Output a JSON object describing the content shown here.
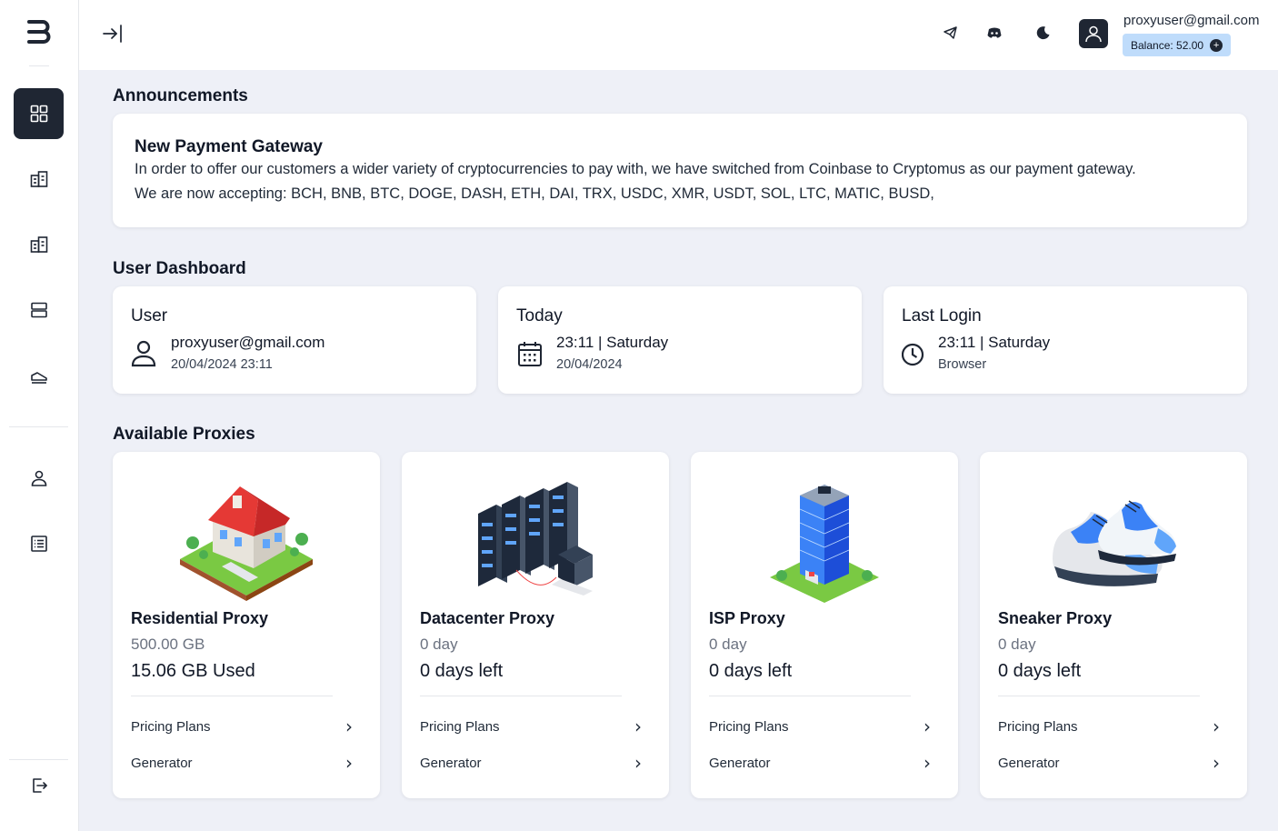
{
  "header": {
    "user_email": "proxyuser@gmail.com",
    "balance_label": "Balance: 52.00",
    "balance_plus": "+"
  },
  "sidebar": {
    "items": [
      {
        "name": "dashboard",
        "icon": "grid-icon",
        "active": true
      },
      {
        "name": "datacenter",
        "icon": "buildings-icon"
      },
      {
        "name": "isp",
        "icon": "buildings-icon"
      },
      {
        "name": "servers",
        "icon": "server-icon"
      },
      {
        "name": "sneaker",
        "icon": "shoe-icon"
      },
      {
        "name": "account",
        "icon": "user-icon"
      },
      {
        "name": "orders",
        "icon": "list-icon"
      },
      {
        "name": "logout",
        "icon": "logout-icon"
      }
    ]
  },
  "announcements": {
    "section_title": "Announcements",
    "title": "New Payment Gateway",
    "line1": "In order to offer our customers a wider variety of cryptocurrencies to pay with, we have switched from Coinbase to Cryptomus as our payment gateway.",
    "line2": "We are now accepting: BCH, BNB, BTC, DOGE, DASH, ETH, DAI, TRX, USDC, XMR, USDT, SOL, LTC, MATIC, BUSD,"
  },
  "dashboard": {
    "section_title": "User Dashboard",
    "cards": [
      {
        "label": "User",
        "main": "proxyuser@gmail.com",
        "sub": "20/04/2024 23:11",
        "icon": "user-icon"
      },
      {
        "label": "Today",
        "main": "23:11 | Saturday",
        "sub": "20/04/2024",
        "icon": "calendar-icon"
      },
      {
        "label": "Last Login",
        "main": "23:11 | Saturday",
        "sub": "Browser",
        "icon": "clock-icon"
      }
    ]
  },
  "proxies": {
    "section_title": "Available Proxies",
    "cards": [
      {
        "name": "Residential Proxy",
        "qty": "500.00 GB",
        "status": "15.06 GB Used",
        "link1": "Pricing Plans",
        "link2": "Generator",
        "image": "house-illustration"
      },
      {
        "name": "Datacenter Proxy",
        "qty": "0 day",
        "status": "0 days left",
        "link1": "Pricing Plans",
        "link2": "Generator",
        "image": "server-racks-illustration"
      },
      {
        "name": "ISP Proxy",
        "qty": "0 day",
        "status": "0 days left",
        "link1": "Pricing Plans",
        "link2": "Generator",
        "image": "office-tower-illustration"
      },
      {
        "name": "Sneaker Proxy",
        "qty": "0 day",
        "status": "0 days left",
        "link1": "Pricing Plans",
        "link2": "Generator",
        "image": "sneakers-illustration"
      }
    ]
  }
}
